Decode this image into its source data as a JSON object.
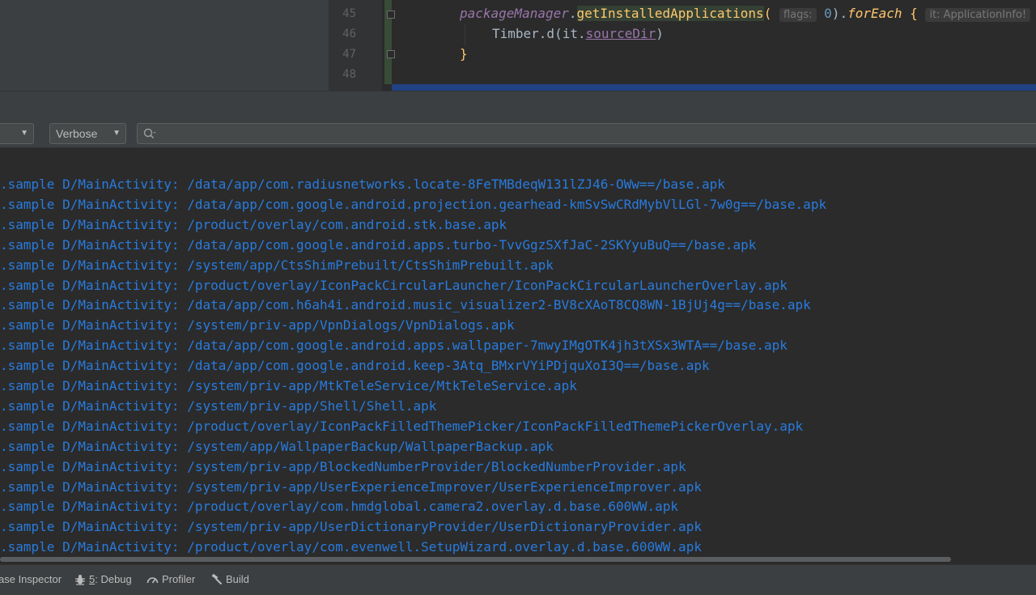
{
  "editor": {
    "lines": [
      {
        "number": "45"
      },
      {
        "number": "46"
      },
      {
        "number": "47"
      },
      {
        "number": "48"
      }
    ],
    "code45": {
      "receiver": "packageManager",
      "dot1": ".",
      "method": "getInstalledApplications",
      "open_paren": "(",
      "hint_flags": "flags:",
      "arg": "0",
      "close_paren": ")",
      "dot2": ".",
      "for_each": "forEach",
      "brace": " {",
      "hint_it": "it: ApplicationInfo!"
    },
    "code46": {
      "call": "Timber.d(it.",
      "prop": "sourceDir",
      "close": ")"
    },
    "code47": {
      "text": "}"
    }
  },
  "logcat": {
    "process_dropdown": {
      "label": ""
    },
    "level_dropdown": {
      "label": "Verbose"
    },
    "search": {
      "placeholder": "",
      "icon": "search-icon"
    },
    "lines": [
      ".sample D/MainActivity: /data/app/com.radiusnetworks.locate-8FeTMBdeqW131lZJ46-OWw==/base.apk",
      ".sample D/MainActivity: /data/app/com.google.android.projection.gearhead-kmSvSwCRdMybVlLGl-7w0g==/base.apk",
      ".sample D/MainActivity: /product/overlay/com.android.stk.base.apk",
      ".sample D/MainActivity: /data/app/com.google.android.apps.turbo-TvvGgzSXfJaC-2SKYyuBuQ==/base.apk",
      ".sample D/MainActivity: /system/app/CtsShimPrebuilt/CtsShimPrebuilt.apk",
      ".sample D/MainActivity: /product/overlay/IconPackCircularLauncher/IconPackCircularLauncherOverlay.apk",
      ".sample D/MainActivity: /data/app/com.h6ah4i.android.music_visualizer2-BV8cXAoT8CQ8WN-1BjUj4g==/base.apk",
      ".sample D/MainActivity: /system/priv-app/VpnDialogs/VpnDialogs.apk",
      ".sample D/MainActivity: /data/app/com.google.android.apps.wallpaper-7mwyIMgOTK4jh3tXSx3WTA==/base.apk",
      ".sample D/MainActivity: /data/app/com.google.android.keep-3Atq_BMxrVYiPDjquXoI3Q==/base.apk",
      ".sample D/MainActivity: /system/priv-app/MtkTeleService/MtkTeleService.apk",
      ".sample D/MainActivity: /system/priv-app/Shell/Shell.apk",
      ".sample D/MainActivity: /product/overlay/IconPackFilledThemePicker/IconPackFilledThemePickerOverlay.apk",
      ".sample D/MainActivity: /system/app/WallpaperBackup/WallpaperBackup.apk",
      ".sample D/MainActivity: /system/priv-app/BlockedNumberProvider/BlockedNumberProvider.apk",
      ".sample D/MainActivity: /system/priv-app/UserExperienceImprover/UserExperienceImprover.apk",
      ".sample D/MainActivity: /product/overlay/com.hmdglobal.camera2.overlay.d.base.600WW.apk",
      ".sample D/MainActivity: /system/priv-app/UserDictionaryProvider/UserDictionaryProvider.apk",
      ".sample D/MainActivity: /product/overlay/com.evenwell.SetupWizard.overlay.d.base.600WW.apk"
    ],
    "log_color": "#287bde"
  },
  "bottom_tools": {
    "inspector": "ase Inspector",
    "debug_mnemonic": "5",
    "debug_rest": ": Debug",
    "profiler": "Profiler",
    "build": "Build"
  }
}
